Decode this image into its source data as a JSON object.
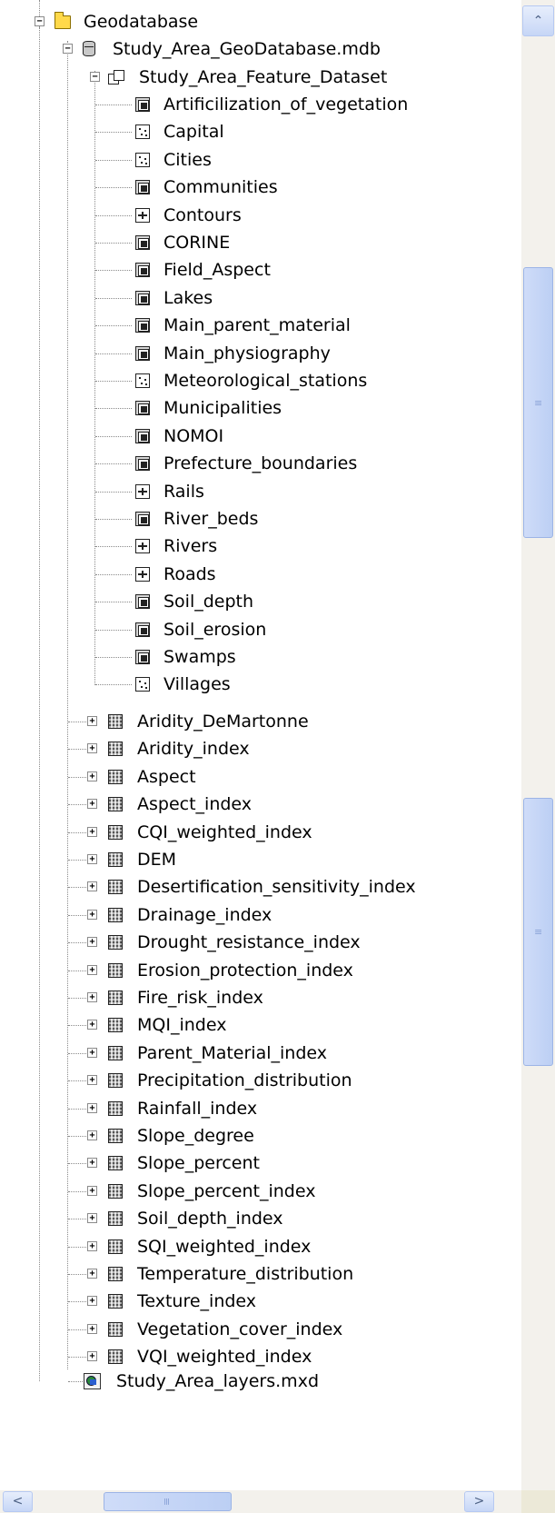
{
  "tree": {
    "root": {
      "label": "Geodatabase",
      "icon": "folder-icon",
      "expander": "−"
    },
    "database": {
      "label": "Study_Area_GeoDatabase.mdb",
      "icon": "database-icon",
      "expander": "−"
    },
    "feature_dataset": {
      "label": "Study_Area_Feature_Dataset",
      "icon": "feature-dataset-icon",
      "expander": "−"
    },
    "feature_classes": [
      {
        "label": "Artificilization_of_vegetation",
        "icon": "polygon-feature-class-icon"
      },
      {
        "label": "Capital",
        "icon": "point-feature-class-icon"
      },
      {
        "label": "Cities",
        "icon": "point-feature-class-icon"
      },
      {
        "label": "Communities",
        "icon": "polygon-feature-class-icon"
      },
      {
        "label": "Contours",
        "icon": "line-feature-class-icon"
      },
      {
        "label": "CORINE",
        "icon": "polygon-feature-class-icon"
      },
      {
        "label": "Field_Aspect",
        "icon": "polygon-feature-class-icon"
      },
      {
        "label": "Lakes",
        "icon": "polygon-feature-class-icon"
      },
      {
        "label": "Main_parent_material",
        "icon": "polygon-feature-class-icon"
      },
      {
        "label": "Main_physiography",
        "icon": "polygon-feature-class-icon"
      },
      {
        "label": "Meteorological_stations",
        "icon": "point-feature-class-icon"
      },
      {
        "label": "Municipalities",
        "icon": "polygon-feature-class-icon"
      },
      {
        "label": "NOMOI",
        "icon": "polygon-feature-class-icon"
      },
      {
        "label": "Prefecture_boundaries",
        "icon": "polygon-feature-class-icon"
      },
      {
        "label": "Rails",
        "icon": "line-feature-class-icon"
      },
      {
        "label": "River_beds",
        "icon": "polygon-feature-class-icon"
      },
      {
        "label": "Rivers",
        "icon": "line-feature-class-icon"
      },
      {
        "label": "Roads",
        "icon": "line-feature-class-icon"
      },
      {
        "label": "Soil_depth",
        "icon": "polygon-feature-class-icon"
      },
      {
        "label": "Soil_erosion",
        "icon": "polygon-feature-class-icon"
      },
      {
        "label": "Swamps",
        "icon": "polygon-feature-class-icon"
      },
      {
        "label": "Villages",
        "icon": "point-feature-class-icon"
      }
    ],
    "rasters": [
      {
        "label": "Aridity_DeMartonne",
        "icon": "raster-icon",
        "expander": "+"
      },
      {
        "label": "Aridity_index",
        "icon": "raster-icon",
        "expander": "+"
      },
      {
        "label": "Aspect",
        "icon": "raster-icon",
        "expander": "+"
      },
      {
        "label": "Aspect_index",
        "icon": "raster-icon",
        "expander": "+"
      },
      {
        "label": "CQI_weighted_index",
        "icon": "raster-icon",
        "expander": "+"
      },
      {
        "label": "DEM",
        "icon": "raster-icon",
        "expander": "+"
      },
      {
        "label": "Desertification_sensitivity_index",
        "icon": "raster-icon",
        "expander": "+"
      },
      {
        "label": "Drainage_index",
        "icon": "raster-icon",
        "expander": "+"
      },
      {
        "label": "Drought_resistance_index",
        "icon": "raster-icon",
        "expander": "+"
      },
      {
        "label": "Erosion_protection_index",
        "icon": "raster-icon",
        "expander": "+"
      },
      {
        "label": "Fire_risk_index",
        "icon": "raster-icon",
        "expander": "+"
      },
      {
        "label": "MQI_index",
        "icon": "raster-icon",
        "expander": "+"
      },
      {
        "label": "Parent_Material_index",
        "icon": "raster-icon",
        "expander": "+"
      },
      {
        "label": "Precipitation_distribution",
        "icon": "raster-icon",
        "expander": "+"
      },
      {
        "label": "Rainfall_index",
        "icon": "raster-icon",
        "expander": "+"
      },
      {
        "label": "Slope_degree",
        "icon": "raster-icon",
        "expander": "+"
      },
      {
        "label": "Slope_percent",
        "icon": "raster-icon",
        "expander": "+"
      },
      {
        "label": "Slope_percent_index",
        "icon": "raster-icon",
        "expander": "+"
      },
      {
        "label": "Soil_depth_index",
        "icon": "raster-icon",
        "expander": "+"
      },
      {
        "label": "SQI_weighted_index",
        "icon": "raster-icon",
        "expander": "+"
      },
      {
        "label": "Temperature_distribution",
        "icon": "raster-icon",
        "expander": "+"
      },
      {
        "label": "Texture_index",
        "icon": "raster-icon",
        "expander": "+"
      },
      {
        "label": "Vegetation_cover_index",
        "icon": "raster-icon",
        "expander": "+"
      },
      {
        "label": "VQI_weighted_index",
        "icon": "raster-icon",
        "expander": "+"
      }
    ],
    "map_document": {
      "label": "Study_Area_layers.mxd",
      "icon": "map-document-icon"
    }
  },
  "scrollbars": {
    "up_arrow": "⌃",
    "down_arrow": "⌄",
    "left_arrow": "<",
    "right_arrow": ">",
    "grip": "≡"
  }
}
